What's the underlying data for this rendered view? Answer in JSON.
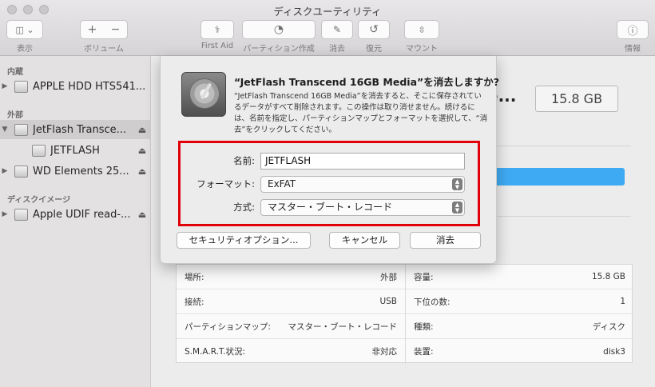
{
  "window": {
    "title": "ディスクユーティリティ"
  },
  "toolbar": {
    "view_label": "表示",
    "volume_label": "ボリューム",
    "first_aid_label": "First Aid",
    "partition_label": "パーティション作成",
    "erase_label": "消去",
    "restore_label": "復元",
    "mount_label": "マウント",
    "info_label": "情報"
  },
  "sidebar": {
    "internal_header": "内蔵",
    "external_header": "外部",
    "images_header": "ディスクイメージ",
    "items": [
      {
        "label": "APPLE HDD HTS541..."
      },
      {
        "label": "JetFlash Transce..."
      },
      {
        "label": "JETFLASH"
      },
      {
        "label": "WD Elements 25..."
      },
      {
        "label": "Apple UDIF read-..."
      }
    ]
  },
  "main": {
    "title_suffix": "e...",
    "capacity": "15.8 GB"
  },
  "info_table": {
    "rows": [
      {
        "left_label": "場所:",
        "left_value": "外部",
        "right_label": "容量:",
        "right_value": "15.8 GB"
      },
      {
        "left_label": "接続:",
        "left_value": "USB",
        "right_label": "下位の数:",
        "right_value": "1"
      },
      {
        "left_label": "パーティションマップ:",
        "left_value": "マスター・ブート・レコード",
        "right_label": "種類:",
        "right_value": "ディスク"
      },
      {
        "left_label": "S.M.A.R.T.状況:",
        "left_value": "非対応",
        "right_label": "装置:",
        "right_value": "disk3"
      }
    ]
  },
  "dialog": {
    "title": "“JetFlash Transcend 16GB Media”を消去しますか?",
    "message": "“JetFlash Transcend 16GB Media”を消去すると、そこに保存されているデータがすべて削除されます。この操作は取り消せません。続けるには、名前を指定し、パーティションマップとフォーマットを選択して、“消去”をクリックしてください。",
    "name_label": "名前:",
    "name_value": "JETFLASH",
    "format_label": "フォーマット:",
    "format_value": "ExFAT",
    "scheme_label": "方式:",
    "scheme_value": "マスター・ブート・レコード",
    "security_button": "セキュリティオプション...",
    "cancel_button": "キャンセル",
    "erase_button": "消去"
  },
  "colors": {
    "highlight_box": "#e1000a",
    "usage_bar": "#3eaaf3"
  }
}
